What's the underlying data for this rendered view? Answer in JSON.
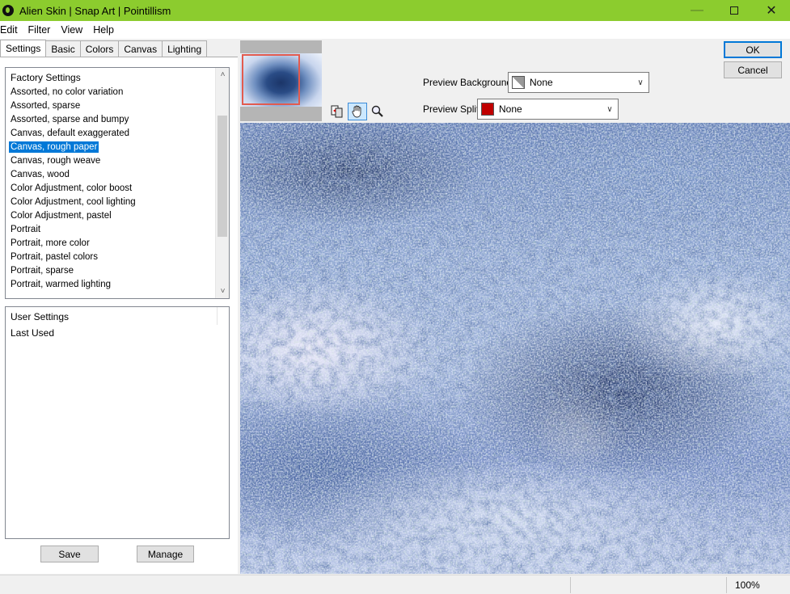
{
  "window": {
    "title": "Alien Skin | Snap Art | Pointillism"
  },
  "menu": [
    "Edit",
    "Filter",
    "View",
    "Help"
  ],
  "tabs": [
    "Settings",
    "Basic",
    "Colors",
    "Canvas",
    "Lighting"
  ],
  "factory_settings": {
    "header": "Factory Settings",
    "items": [
      "Assorted, no color variation",
      "Assorted, sparse",
      "Assorted, sparse and bumpy",
      "Canvas, default exaggerated",
      "Canvas, rough paper",
      "Canvas, rough weave",
      "Canvas, wood",
      "Color Adjustment, color boost",
      "Color Adjustment, cool lighting",
      "Color Adjustment, pastel",
      "Portrait",
      "Portrait, more color",
      "Portrait, pastel colors",
      "Portrait, sparse",
      "Portrait, warmed lighting"
    ],
    "selected": "Canvas, rough paper",
    "scroll_position": 0.42
  },
  "user_settings": {
    "header": "User Settings",
    "items": [
      "Last Used"
    ]
  },
  "buttons": {
    "save": "Save",
    "manage": "Manage",
    "ok": "OK",
    "cancel": "Cancel"
  },
  "preview_background": {
    "label": "Preview Background:",
    "value": "None"
  },
  "preview_split": {
    "label": "Preview Split:",
    "value": "None",
    "swatch_color": "#c00000"
  },
  "tools": [
    "compare-icon",
    "hand-icon",
    "zoom-icon"
  ],
  "status": {
    "zoom": "100%"
  },
  "colors": {
    "titlebar": "#8ccc2e",
    "selection": "#0078d7",
    "accent_border": "#0078d7"
  }
}
